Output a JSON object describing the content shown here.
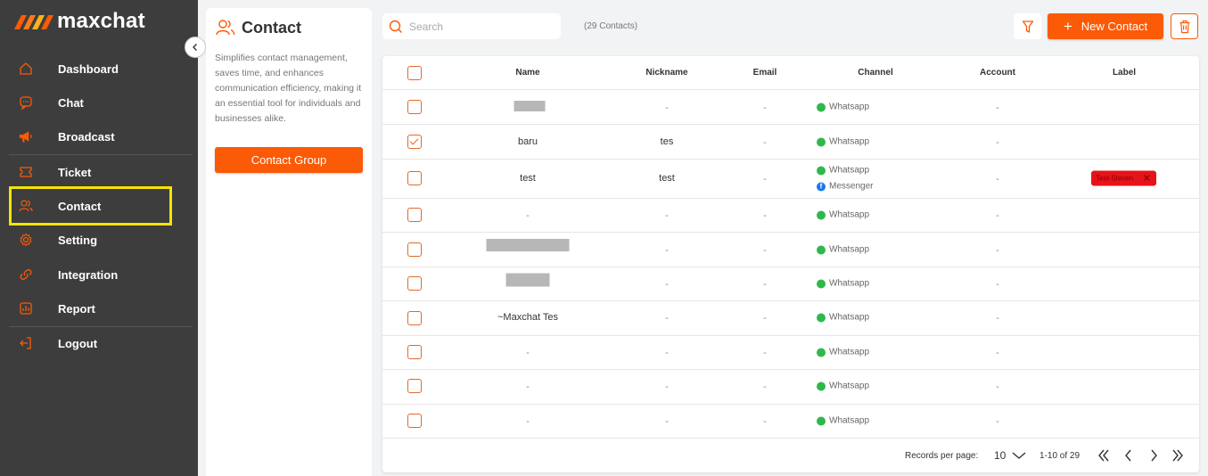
{
  "brand": {
    "name": "maxchat"
  },
  "sidebar": {
    "items": [
      {
        "label": "Dashboard",
        "icon": "home-icon"
      },
      {
        "label": "Chat",
        "icon": "chat-bubble-icon"
      },
      {
        "label": "Broadcast",
        "icon": "megaphone-icon"
      },
      {
        "label": "Ticket",
        "icon": "ticket-icon"
      },
      {
        "label": "Contact",
        "icon": "users-icon"
      },
      {
        "label": "Setting",
        "icon": "gear-icon"
      },
      {
        "label": "Integration",
        "icon": "link-icon"
      },
      {
        "label": "Report",
        "icon": "report-icon"
      },
      {
        "label": "Logout",
        "icon": "logout-icon"
      }
    ]
  },
  "contact_panel": {
    "title": "Contact",
    "description": "Simplifies contact management, saves time, and enhances communication efficiency, making it an essential tool for individuals and businesses alike.",
    "group_button": "Contact Group"
  },
  "toolbar": {
    "search_placeholder": "Search",
    "count": "(29 Contacts)",
    "new_contact": "New Contact"
  },
  "table": {
    "headers": [
      "Name",
      "Nickname",
      "Email",
      "Channel",
      "Account",
      "Label"
    ],
    "rows": [
      {
        "name": "",
        "nickname": "-",
        "email": "-",
        "channels": [
          "Whatsapp"
        ],
        "account": "-",
        "label": "",
        "checked": false
      },
      {
        "name": "baru",
        "nickname": "tes",
        "email": "-",
        "channels": [
          "Whatsapp"
        ],
        "account": "-",
        "label": "",
        "checked": true
      },
      {
        "name": "test",
        "nickname": "test",
        "email": "-",
        "channels": [
          "Whatsapp",
          "Messenger"
        ],
        "account": "-",
        "label": "Test-Steven",
        "checked": false
      },
      {
        "name": "-",
        "nickname": "-",
        "email": "-",
        "channels": [
          "Whatsapp"
        ],
        "account": "-",
        "label": "",
        "checked": false
      },
      {
        "name": "",
        "nickname": "-",
        "email": "-",
        "channels": [
          "Whatsapp"
        ],
        "account": "-",
        "label": "",
        "checked": false
      },
      {
        "name": "",
        "nickname": "-",
        "email": "-",
        "channels": [
          "Whatsapp"
        ],
        "account": "-",
        "label": "",
        "checked": false
      },
      {
        "name": "~Maxchat Tes",
        "nickname": "-",
        "email": "-",
        "channels": [
          "Whatsapp"
        ],
        "account": "-",
        "label": "",
        "checked": false
      },
      {
        "name": "-",
        "nickname": "-",
        "email": "-",
        "channels": [
          "Whatsapp"
        ],
        "account": "-",
        "label": "",
        "checked": false
      },
      {
        "name": "-",
        "nickname": "-",
        "email": "-",
        "channels": [
          "Whatsapp"
        ],
        "account": "-",
        "label": "",
        "checked": false
      },
      {
        "name": "-",
        "nickname": "-",
        "email": "-",
        "channels": [
          "Whatsapp"
        ],
        "account": "-",
        "label": "",
        "checked": false
      }
    ]
  },
  "pagination": {
    "records_label": "Records per page:",
    "per_page": "10",
    "range": "1-10 of 29"
  },
  "colors": {
    "accent": "#fb5a07",
    "sidebar_bg": "#3d3d3d",
    "highlight": "#f5e400",
    "label_red": "#e8121a"
  }
}
